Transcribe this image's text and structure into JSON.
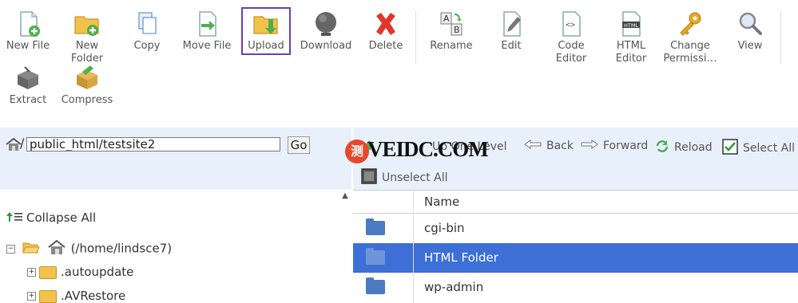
{
  "toolbar": {
    "buttons": [
      {
        "label": "New File",
        "icon": "new-file-icon"
      },
      {
        "label": "New Folder",
        "icon": "new-folder-icon"
      },
      {
        "label": "Copy",
        "icon": "copy-icon"
      },
      {
        "label": "Move File",
        "icon": "move-file-icon"
      },
      {
        "label": "Upload",
        "icon": "upload-icon"
      },
      {
        "label": "Download",
        "icon": "download-icon"
      },
      {
        "label": "Delete",
        "icon": "delete-icon"
      },
      {
        "label": "Rename",
        "icon": "rename-icon"
      },
      {
        "label": "Edit",
        "icon": "edit-icon"
      },
      {
        "label": "Code Editor",
        "icon": "code-editor-icon"
      },
      {
        "label": "HTML Editor",
        "icon": "html-editor-icon"
      },
      {
        "label": "Change Permissi…",
        "icon": "change-permissions-icon"
      },
      {
        "label": "View",
        "icon": "view-icon"
      },
      {
        "label": "Extract",
        "icon": "extract-icon"
      },
      {
        "label": "Compress",
        "icon": "compress-icon"
      }
    ],
    "active": "Upload"
  },
  "pathbar": {
    "slash": "/",
    "path_value": "public_html/testsite2",
    "go_label": "Go"
  },
  "nav": {
    "up_label": "Up One Level",
    "back_label": "Back",
    "forward_label": "Forward",
    "reload_label": "Reload",
    "select_all_label": "Select All",
    "unselect_all_label": "Unselect All"
  },
  "tree": {
    "collapse_all_label": "Collapse All",
    "root_label": "(/home/lindsce7)",
    "items": [
      {
        "label": ".autoupdate"
      },
      {
        "label": ".AVRestore"
      }
    ]
  },
  "filelist": {
    "column_name": "Name",
    "rows": [
      {
        "name": "cgi-bin",
        "selected": false
      },
      {
        "name": "HTML Folder",
        "selected": true
      },
      {
        "name": "wp-admin",
        "selected": false
      }
    ]
  },
  "watermark": {
    "glyph": "测",
    "text": "VEIDC.COM"
  },
  "colors": {
    "selection": "#3d6fd6",
    "header_bg": "#e8f1fb",
    "upload_highlight": "#6a3fb0"
  }
}
